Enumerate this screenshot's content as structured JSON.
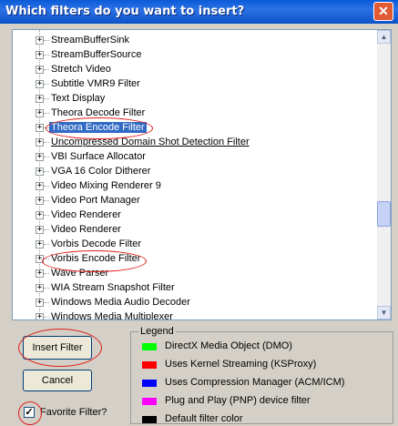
{
  "window": {
    "title": "Which filters do you want to insert?",
    "close_glyph": "✕"
  },
  "filters": [
    {
      "label": "StreamBufferSink"
    },
    {
      "label": "StreamBufferSource"
    },
    {
      "label": "Stretch Video"
    },
    {
      "label": "Subtitle VMR9 Filter"
    },
    {
      "label": "Text Display"
    },
    {
      "label": "Theora Decode Filter"
    },
    {
      "label": "Theora Encode Filter",
      "selected": true
    },
    {
      "label": "Uncompressed Domain Shot Detection Filter",
      "underline": true
    },
    {
      "label": "VBI Surface Allocator"
    },
    {
      "label": "VGA 16 Color Ditherer"
    },
    {
      "label": "Video Mixing Renderer 9"
    },
    {
      "label": "Video Port Manager"
    },
    {
      "label": "Video Renderer"
    },
    {
      "label": "Video Renderer"
    },
    {
      "label": "Vorbis Decode Filter"
    },
    {
      "label": "Vorbis Encode Filter"
    },
    {
      "label": "Wave Parser"
    },
    {
      "label": "WIA Stream Snapshot Filter"
    },
    {
      "label": "Windows Media Audio Decoder"
    },
    {
      "label": "Windows Media Multiplexer"
    }
  ],
  "expander_glyph": "+",
  "buttons": {
    "insert": "Insert Filter",
    "cancel": "Cancel"
  },
  "favorite": {
    "label": "Favorite Filter?",
    "checked": true,
    "check_glyph": "✓"
  },
  "legend": {
    "title": "Legend",
    "items": [
      {
        "label": "DirectX Media Object (DMO)",
        "color": "#00ff00"
      },
      {
        "label": "Uses Kernel Streaming (KSProxy)",
        "color": "#ff0000"
      },
      {
        "label": "Uses Compression Manager (ACM/ICM)",
        "color": "#0000ff"
      },
      {
        "label": "Plug and Play (PNP) device filter",
        "color": "#ff00ff"
      },
      {
        "label": "Default filter color",
        "color": "#000000"
      }
    ]
  },
  "scrollbar": {
    "up_glyph": "▲",
    "down_glyph": "▼"
  },
  "annotation_color": "#e0201a"
}
